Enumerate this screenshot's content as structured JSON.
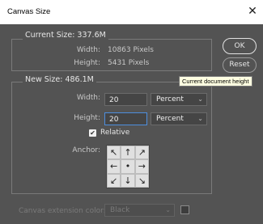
{
  "window": {
    "title": "Canvas Size",
    "close_glyph": "✕"
  },
  "current_size": {
    "legend": "Current Size: 337.6M",
    "width_label": "Width:",
    "width_value": "10863 Pixels",
    "height_label": "Height:",
    "height_value": "5431 Pixels"
  },
  "new_size": {
    "legend": "New Size: 486.1M",
    "width_label": "Width:",
    "width_value": "20",
    "width_unit": "Percent",
    "height_label": "Height:",
    "height_value": "20",
    "height_unit": "Percent",
    "relative_label": "Relative",
    "relative_checked": true,
    "anchor_label": "Anchor:",
    "anchor_arrows": [
      "↖",
      "↑",
      "↗",
      "←",
      "•",
      "→",
      "↙",
      "↓",
      "↘"
    ]
  },
  "buttons": {
    "ok": "OK",
    "reset": "Reset"
  },
  "tooltip": "Current document height",
  "extension": {
    "label": "Canvas extension color:",
    "value": "Black"
  },
  "icons": {
    "chevron": "⌄",
    "check": "✔"
  }
}
